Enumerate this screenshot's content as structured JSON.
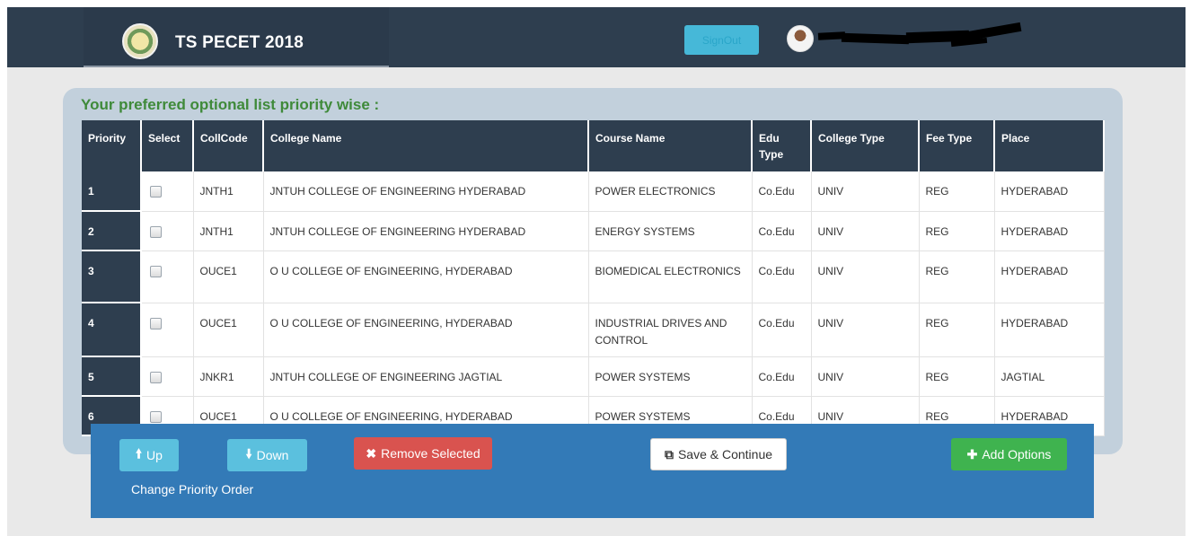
{
  "header": {
    "brand": "TS PECET 2018",
    "signout_label": "SignOut"
  },
  "panel": {
    "title": "Your preferred optional list priority wise :"
  },
  "table": {
    "columns": [
      "Priority",
      "Select",
      "CollCode",
      "College Name",
      "Course Name",
      "Edu Type",
      "College Type",
      "Fee Type",
      "Place"
    ],
    "rows": [
      {
        "priority": "1",
        "coll_code": "JNTH1",
        "college_name": "JNTUH COLLEGE OF ENGINEERING HYDERABAD",
        "course_name": "POWER ELECTRONICS",
        "edu_type": "Co.Edu",
        "college_type": "UNIV",
        "fee_type": "REG",
        "place": "HYDERABAD"
      },
      {
        "priority": "2",
        "coll_code": "JNTH1",
        "college_name": "JNTUH COLLEGE OF ENGINEERING HYDERABAD",
        "course_name": "ENERGY SYSTEMS",
        "edu_type": "Co.Edu",
        "college_type": "UNIV",
        "fee_type": "REG",
        "place": "HYDERABAD"
      },
      {
        "priority": "3",
        "coll_code": "OUCE1",
        "college_name": "O U COLLEGE OF ENGINEERING, HYDERABAD",
        "course_name": "BIOMEDICAL ELECTRONICS",
        "edu_type": "Co.Edu",
        "college_type": "UNIV",
        "fee_type": "REG",
        "place": "HYDERABAD"
      },
      {
        "priority": "4",
        "coll_code": "OUCE1",
        "college_name": "O U COLLEGE OF ENGINEERING, HYDERABAD",
        "course_name": "INDUSTRIAL DRIVES AND CONTROL",
        "edu_type": "Co.Edu",
        "college_type": "UNIV",
        "fee_type": "REG",
        "place": "HYDERABAD"
      },
      {
        "priority": "5",
        "coll_code": "JNKR1",
        "college_name": "JNTUH COLLEGE OF ENGINEERING JAGTIAL",
        "course_name": "POWER SYSTEMS",
        "edu_type": "Co.Edu",
        "college_type": "UNIV",
        "fee_type": "REG",
        "place": "JAGTIAL"
      },
      {
        "priority": "6",
        "coll_code": "OUCE1",
        "college_name": "O U COLLEGE OF ENGINEERING, HYDERABAD",
        "course_name": "POWER SYSTEMS",
        "edu_type": "Co.Edu",
        "college_type": "UNIV",
        "fee_type": "REG",
        "place": "HYDERABAD"
      }
    ]
  },
  "actions": {
    "up_label": "Up",
    "down_label": "Down",
    "remove_label": "Remove Selected",
    "save_label": "Save & Continue",
    "add_label": "Add Options",
    "change_priority_label": "Change Priority Order"
  },
  "colors": {
    "navbar": "#2e3e4f",
    "panel": "#c2d0dc",
    "title_green": "#3f8a3a",
    "action_bar": "#337ab7",
    "info": "#5bc0de",
    "danger": "#d9534f",
    "success": "#3fb34f"
  },
  "icons": {
    "up": "arrow-up-icon",
    "down": "arrow-down-icon",
    "remove": "x-icon",
    "save": "save-continue-icon",
    "add": "plus-icon"
  }
}
